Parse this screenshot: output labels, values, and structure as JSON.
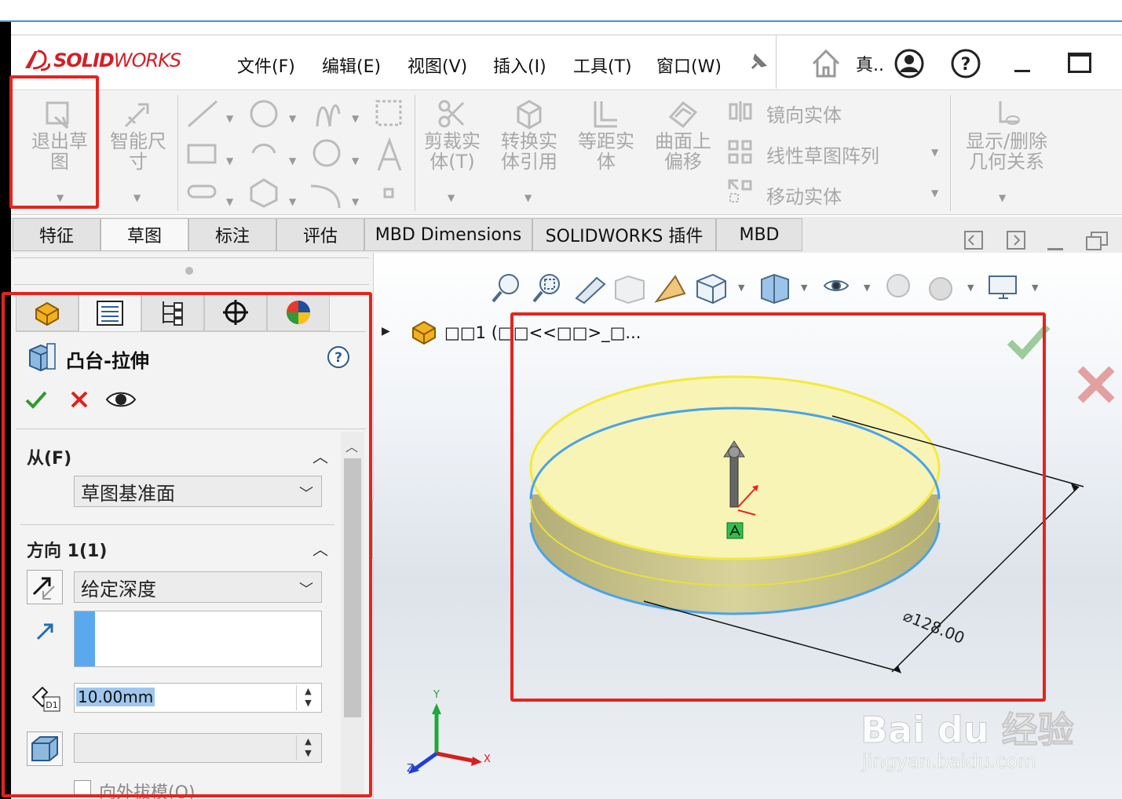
{
  "app": {
    "brand_prefix": "SOLID",
    "brand_suffix": "WORKS"
  },
  "menu": {
    "items": [
      "文件(F)",
      "编辑(E)",
      "视图(V)",
      "插入(I)",
      "工具(T)",
      "窗口(W)"
    ],
    "user_short": "真.."
  },
  "ribbon": {
    "exit_sketch": "退出草图",
    "smart_dim": "智能尺寸",
    "trim": "剪裁实体(T)",
    "convert": "转换实体引用",
    "offset": "等距实体",
    "surface_offset": "曲面上偏移",
    "mirror": "镜向实体",
    "linear_pattern": "线性草图阵列",
    "move": "移动实体",
    "relations": "显示/删除几何关系"
  },
  "tabs": [
    "特征",
    "草图",
    "标注",
    "评估",
    "MBD Dimensions",
    "SOLIDWORKS 插件",
    "MBD"
  ],
  "property_manager": {
    "title": "凸台-拉伸",
    "from_label": "从(F)",
    "from_value": "草图基准面",
    "direction_label": "方向 1(1)",
    "end_condition": "给定深度",
    "depth_value": "10.00mm",
    "draft_label": "向外拔模(O)"
  },
  "tree": {
    "part_label": "□□1  (□□<<□□>_□..."
  },
  "viewport": {
    "dimension": "⌀128.00",
    "axis_x": "X",
    "axis_y": "Y",
    "axis_z": "Z"
  },
  "watermark": {
    "brand": "Bai du 经验",
    "url": "jingyan.baidu.com"
  },
  "colors": {
    "accent_red": "#e4241f",
    "disk_face": "#f7f4b5",
    "disk_edge": "#4aa3e8",
    "brand": "#d41f26"
  }
}
